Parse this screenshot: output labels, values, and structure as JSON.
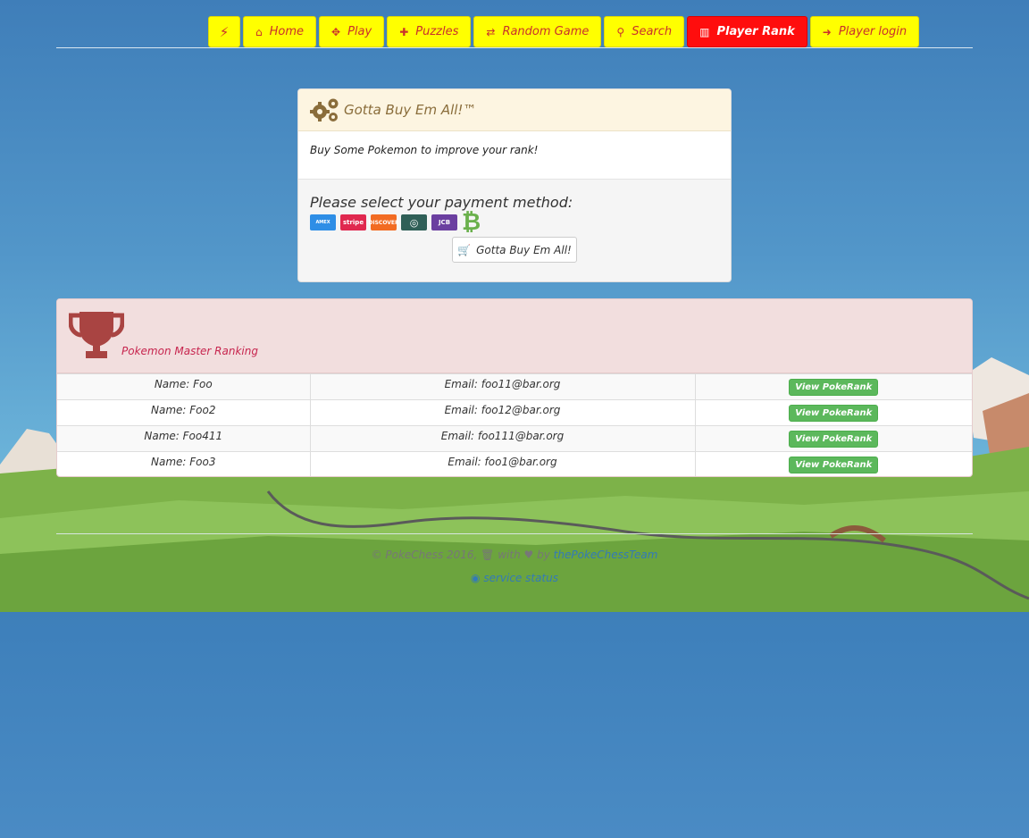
{
  "nav": {
    "items": [
      {
        "label": "Home",
        "icon": "home-icon"
      },
      {
        "label": "Play",
        "icon": "gamepad-icon"
      },
      {
        "label": "Puzzles",
        "icon": "puzzle-icon"
      },
      {
        "label": "Random Game",
        "icon": "random-icon"
      },
      {
        "label": "Search",
        "icon": "search-icon"
      },
      {
        "label": "Player Rank",
        "icon": "bar-chart-icon",
        "active": true
      },
      {
        "label": "Player login",
        "icon": "sign-in-icon"
      }
    ]
  },
  "shop": {
    "title": "Gotta Buy Em All!™",
    "body": "Buy Some Pokemon to improve your rank!",
    "payment_title": "Please select your payment method:",
    "cards": [
      "AMERICAN EXPRESS",
      "stripe",
      "DISCOVER",
      "Diners",
      "JCB",
      "bitcoin"
    ],
    "buy_label": "Gotta Buy Em All!"
  },
  "ranking": {
    "title": "Pokemon Master Ranking",
    "button_label": "View PokeRank",
    "rows": [
      {
        "name": "Name: Foo",
        "email": "Email: foo11@bar.org"
      },
      {
        "name": "Name: Foo2",
        "email": "Email: foo12@bar.org"
      },
      {
        "name": "Name: Foo411",
        "email": "Email: foo111@bar.org"
      },
      {
        "name": "Name: Foo3",
        "email": "Email: foo1@bar.org"
      }
    ]
  },
  "footer": {
    "copyright": "© PokeChess 2016,",
    "with": "with",
    "by": "by",
    "team": "thePokeChessTeam",
    "status": "service status"
  },
  "colors": {
    "nav_bg": "#ffff00",
    "nav_active": "#ff0d0d",
    "rank_header": "#f2dede",
    "view_button": "#5cb85c"
  }
}
